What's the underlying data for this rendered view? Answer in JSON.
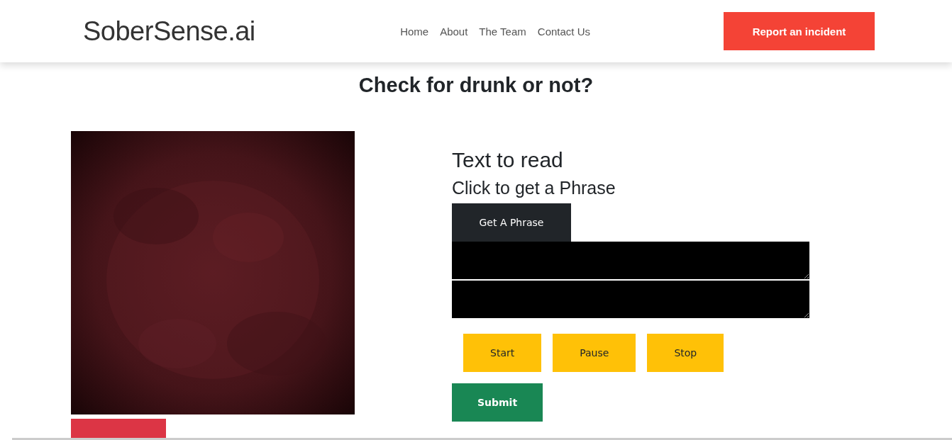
{
  "header": {
    "logo": "SoberSense.ai",
    "nav": [
      {
        "label": "Home"
      },
      {
        "label": "About"
      },
      {
        "label": "The Team"
      },
      {
        "label": "Contact Us"
      }
    ],
    "report_button": "Report an incident"
  },
  "heading": "Check for drunk or not?",
  "reader": {
    "title": "Text to read",
    "subtitle": "Click to get a Phrase",
    "phrase_button": "Get A Phrase",
    "fields": [
      {
        "kind": "output"
      },
      {
        "kind": "output"
      }
    ],
    "recording_buttons": [
      {
        "label": "Start"
      },
      {
        "label": "Pause"
      },
      {
        "label": "Stop"
      }
    ],
    "submit_button": "Submit"
  }
}
